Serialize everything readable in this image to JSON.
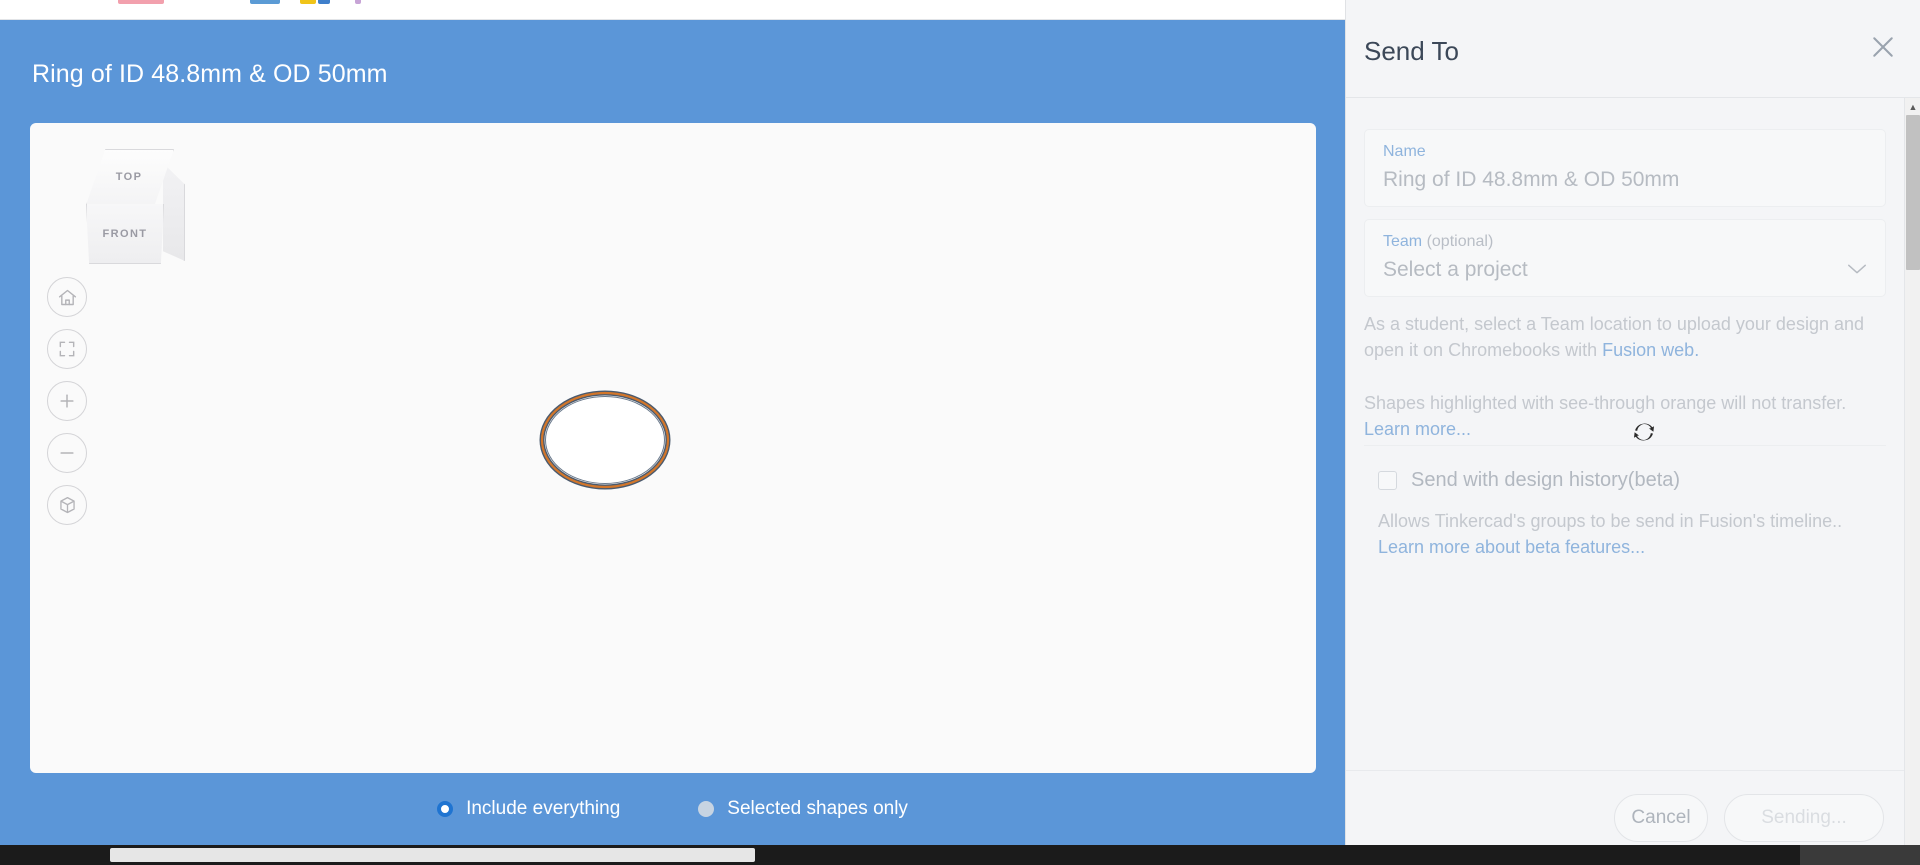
{
  "dialog": {
    "title": "Ring of ID 48.8mm & OD 50mm",
    "viewcube": {
      "top_label": "TOP",
      "front_label": "FRONT"
    },
    "tools": [
      {
        "name": "home-icon"
      },
      {
        "name": "fit-view-icon"
      },
      {
        "name": "zoom-in-icon"
      },
      {
        "name": "zoom-out-icon"
      },
      {
        "name": "ortho-view-icon"
      }
    ],
    "scope_options": [
      {
        "label": "Include everything",
        "selected": true
      },
      {
        "label": "Selected shapes only",
        "selected": false
      }
    ]
  },
  "send_panel": {
    "title": "Send To",
    "close_label": "✕",
    "name_field": {
      "label": "Name",
      "value": "Ring of ID 48.8mm & OD 50mm"
    },
    "team_field": {
      "label": "Team",
      "optional_suffix": " (optional)",
      "value": "Select a project"
    },
    "note_1_prefix": "As a student, select a Team location to upload your design and open it on Chromebooks with ",
    "note_1_link": "Fusion web.",
    "note_2_prefix": "Shapes highlighted with see-through orange will not transfer. ",
    "note_2_link": "Learn more...",
    "checkbox": {
      "label": "Send with design history(beta)",
      "checked": false
    },
    "beta_note_prefix": "Allows Tinkercad's groups to be send in Fusion's timeline.. ",
    "beta_note_link": "Learn more about beta features...",
    "cancel_label": "Cancel",
    "send_label": "Sending..."
  },
  "colors": {
    "dialog_blue": "#5b96d8",
    "radio_accent": "#1f74d1",
    "link_blue": "#8fb4dd",
    "model_outline": "#4a5a6e",
    "model_highlight": "#d2762a"
  }
}
